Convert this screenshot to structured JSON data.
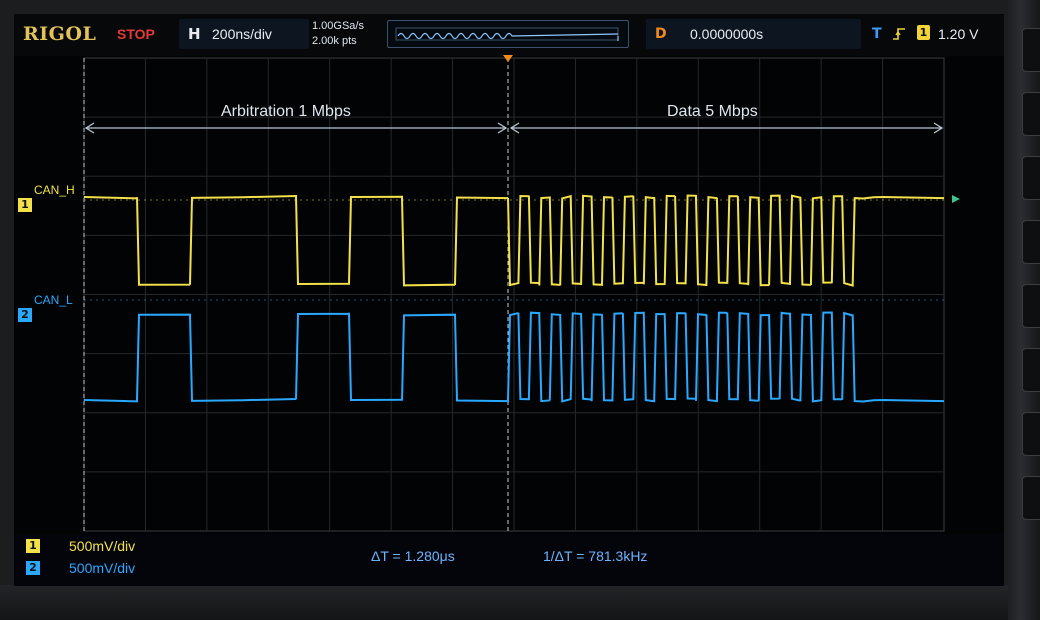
{
  "header": {
    "brand": "RIGOL",
    "run_state": "STOP",
    "horizontal": {
      "key": "H",
      "scale": "200ns/div"
    },
    "acquisition": {
      "sample_rate": "1.00GSa/s",
      "memory_depth": "2.00k pts"
    },
    "delay": {
      "key": "D",
      "value": "0.0000000s"
    },
    "trigger": {
      "key": "T",
      "edge_icon": "rising-edge-icon",
      "source": "1",
      "level": "1.20 V"
    }
  },
  "annotations": {
    "arbitration": "Arbitration 1 Mbps",
    "data": "Data 5 Mbps"
  },
  "channels": [
    {
      "number": "1",
      "label": "CAN_H",
      "scale": "500mV/div",
      "color": "#f2e14a"
    },
    {
      "number": "2",
      "label": "CAN_L",
      "scale": "500mV/div",
      "color": "#2aa8ff"
    }
  ],
  "measurements": {
    "delta_t": "ΔT = 1.280μs",
    "inverse_delta_t": "1/ΔT = 781.3kHz"
  },
  "signals": {
    "arbitration_bit_levels": [
      1,
      0,
      1,
      1,
      0,
      1,
      0,
      1
    ],
    "data_bit_levels": [
      0,
      1,
      0,
      1,
      0,
      1,
      0,
      1,
      0,
      1,
      0,
      1,
      0,
      1,
      0,
      1,
      0,
      1,
      0,
      1,
      0,
      1,
      0,
      1,
      0,
      1,
      0,
      1,
      0,
      1,
      0,
      1,
      0,
      1,
      1,
      1
    ],
    "idle_end_level": 1
  },
  "colors": {
    "background": "#020304",
    "grid": "#2f3336",
    "cursor": "#c8ced6",
    "accent_orange": "#f28a1e",
    "accent_blue": "#3f9bff"
  }
}
